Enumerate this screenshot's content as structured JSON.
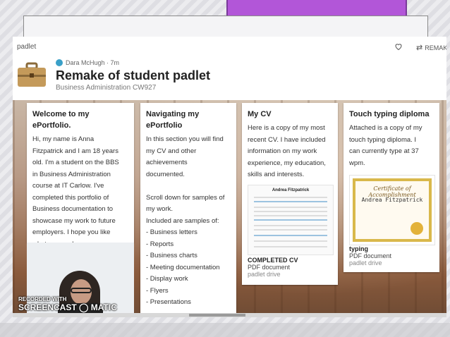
{
  "app": {
    "brand": "padlet",
    "remake_label": "REMAK"
  },
  "post": {
    "author": "Dara McHugh",
    "time": "7m",
    "title": "Remake of student padlet",
    "subtitle": "Business Administration CW927"
  },
  "cards": [
    {
      "title": "Welcome to my ePortfolio.",
      "body": "Hi, my name is Anna\nFitzpatrick and I am 18 years\nold.  I'm a student on the BBS\nin Business Administration\ncourse at IT Carlow. I've\ncompleted this portfolio of\nBusiness documentation to\nshowcase my work to future\nemployers. I hope you like\nwhat you see!"
    },
    {
      "title": "Navigating my\nePortfolio",
      "body": "In this section you will find\nmy CV and other\nachievements\ndocumented.\n\nScroll down for samples of\nmy work.\nIncluded are samples of:\n- Business letters\n- Reports\n- Business charts\n- Meeting documentation\n- Display work\n- Flyers\n- Presentations"
    },
    {
      "title": "My CV",
      "body": "Here is a copy of my most\nrecent CV. I have included\ninformation on my work\nexperience, my education,\nskills and interests.",
      "attachment": {
        "name": "COMPLETED CV",
        "type": "PDF document",
        "source": "padlet drive"
      },
      "doc_heading": "Andrea Fitzpatrick"
    },
    {
      "title": "Touch typing diploma",
      "body": "Attached is a copy of my\ntouch typing diploma. I\ncan currently type at 37\nwpm.",
      "attachment": {
        "name": "typing",
        "type": "PDF document",
        "source": "padlet drive"
      },
      "certificate": {
        "heading": "Certificate of Accomplishment",
        "name": "Andrea Fitzpatrick"
      }
    }
  ],
  "watermark": {
    "line1": "RECORDED WITH",
    "line2": "SCREENCAST ◯ MATIC"
  },
  "colors": {
    "accent_slide": "#b256d8",
    "board_tone": "#a27a60"
  }
}
